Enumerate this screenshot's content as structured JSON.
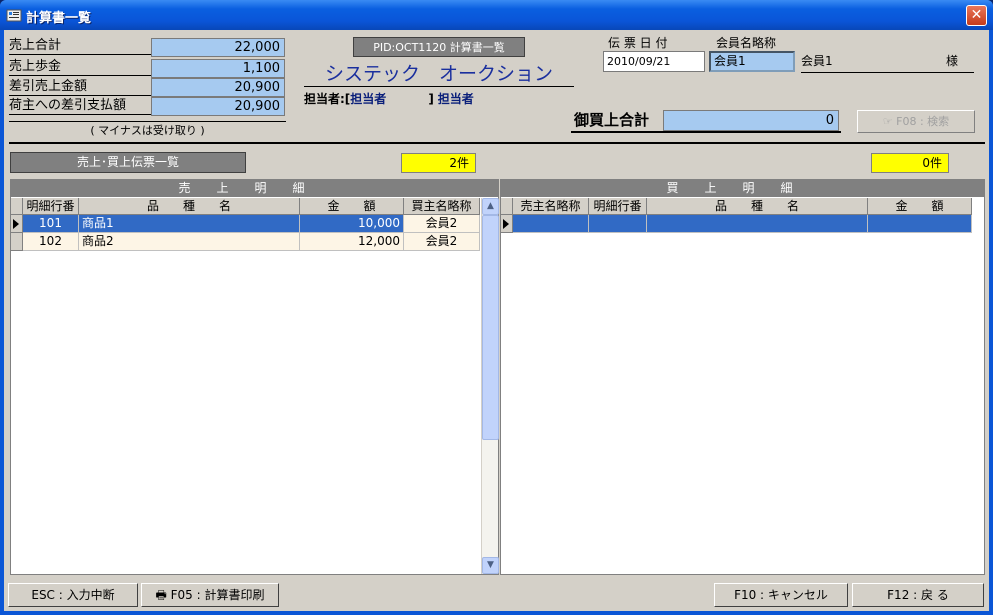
{
  "window": {
    "title": "計算書一覧",
    "close": "✕"
  },
  "summary": {
    "rows": [
      {
        "label": "売上合計",
        "value": "22,000"
      },
      {
        "label": "売上歩金",
        "value": "1,100"
      },
      {
        "label": "差引売上金額",
        "value": "20,900"
      },
      {
        "label": "荷主への差引支払額",
        "value": "20,900"
      }
    ],
    "note": "( マイナスは受け取り )"
  },
  "header": {
    "pid": "PID:OCT1120 計算書一覧",
    "company": "システック　オークション",
    "tanto_label": "担当者:[",
    "tanto_value": "担当者",
    "tanto_close": "]",
    "tanto_value2": "担当者"
  },
  "slip": {
    "date_label": "伝 票 日 付",
    "date_value": "2010/09/21",
    "member_label": "会員名略称",
    "member_code": "会員1",
    "member_name": "会員1",
    "honorific": "様"
  },
  "buy_total": {
    "label": "御買上合計",
    "value": "0"
  },
  "search_button": "F08 : 検索",
  "list_button": "売上･買上伝票一覧",
  "sales": {
    "count": "2件",
    "title": "売上明細",
    "columns": [
      "明細行番",
      "品　　種　　名",
      "金　　額",
      "買主名略称"
    ],
    "rows": [
      {
        "no": "101",
        "name": "商品1",
        "amount": "10,000",
        "buyer": "会員2"
      },
      {
        "no": "102",
        "name": "商品2",
        "amount": "12,000",
        "buyer": "会員2"
      }
    ]
  },
  "purchase": {
    "count": "0件",
    "title": "買上明細",
    "columns": [
      "売主名略称",
      "明細行番",
      "品　　種　　名",
      "金　　額"
    ]
  },
  "footer": {
    "esc": "ESC : 入力中断",
    "f05": "F05 : 計算書印刷",
    "f10": "F10 : キャンセル",
    "f12": "F12 : 戻 る"
  }
}
